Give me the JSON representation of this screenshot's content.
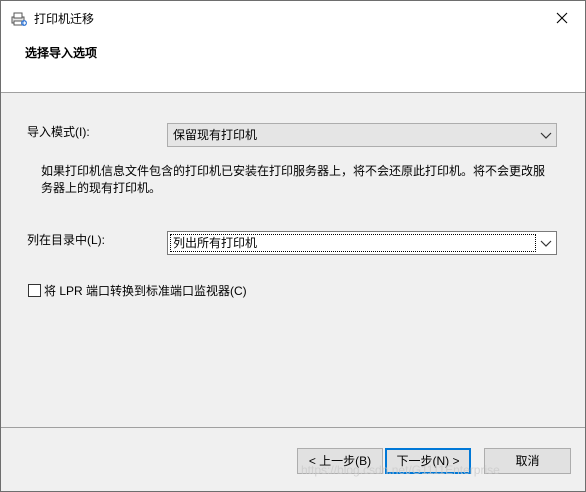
{
  "window": {
    "title": "打印机迁移",
    "icon": "printer-migration-icon",
    "close_icon": "close-icon"
  },
  "header": {
    "title": "选择导入选项"
  },
  "import_mode": {
    "label": "导入模式(I):",
    "value": "保留现有打印机"
  },
  "description": "如果打印机信息文件包含的打印机已安装在打印服务器上，将不会还原此打印机。将不会更改服务器上的现有打印机。",
  "list_in_directory": {
    "label": "列在目录中(L):",
    "value": "列出所有打印机"
  },
  "lpr_checkbox": {
    "label": "将 LPR 端口转换到标准端口监视器(C)",
    "checked": false
  },
  "buttons": {
    "back": "< 上一步(B)",
    "next": "下一步(N) >",
    "cancel": "取消"
  },
  "watermark": "https://blog.csdn.net/G1111Enterprise",
  "colors": {
    "focus_border": "#0078d7",
    "button_bg": "#e1e1e1",
    "dialog_bg": "#f0f0f0"
  }
}
